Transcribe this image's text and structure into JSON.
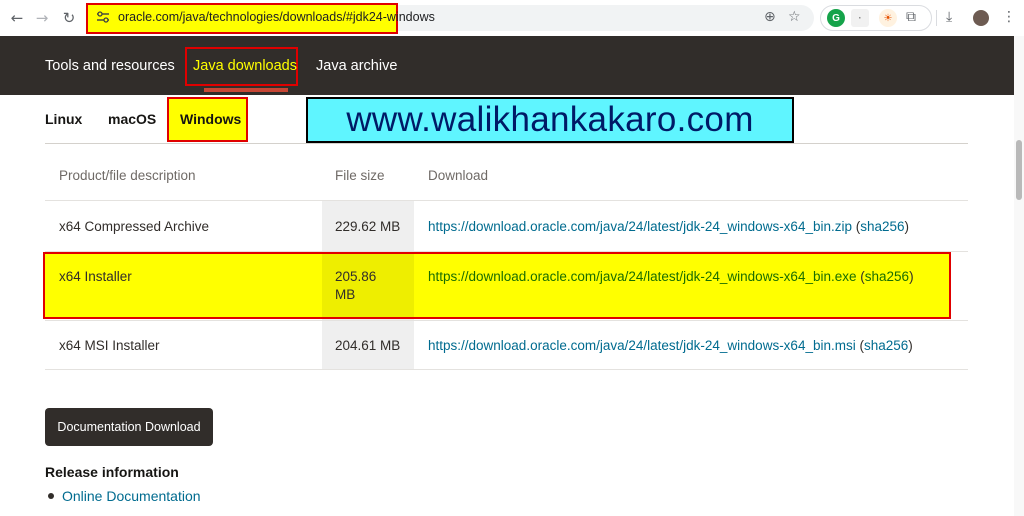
{
  "browser": {
    "url": "oracle.com/java/technologies/downloads/#jdk24-windows",
    "icons": [
      "back-icon",
      "forward-icon",
      "reload-icon",
      "site-info-icon",
      "zoom-icon",
      "bookmark-star-icon",
      "extension-puzzle-icon",
      "download-icon",
      "profile-avatar",
      "menu-icon"
    ]
  },
  "topnav": {
    "items": [
      "Tools and resources",
      "Java downloads",
      "Java archive"
    ],
    "active": "Java downloads"
  },
  "os_tabs": {
    "items": [
      "Linux",
      "macOS",
      "Windows"
    ],
    "active": "Windows"
  },
  "watermark": "www.walikhankakaro.com",
  "table": {
    "headers": [
      "Product/file description",
      "File size",
      "Download"
    ],
    "rows": [
      {
        "description": "x64 Compressed Archive",
        "size": "229.62 MB",
        "link": "https://download.oracle.com/java/24/latest/jdk-24_windows-x64_bin.zip",
        "checksum": "sha256"
      },
      {
        "description": "x64 Installer",
        "size_line1": "205.86",
        "size_line2": "MB",
        "link": "https://download.oracle.com/java/24/latest/jdk-24_windows-x64_bin.exe",
        "checksum": "sha256"
      },
      {
        "description": "x64 MSI Installer",
        "size": "204.61 MB",
        "link": "https://download.oracle.com/java/24/latest/jdk-24_windows-x64_bin.msi",
        "checksum": "sha256"
      }
    ]
  },
  "documentation_button": "Documentation Download",
  "release": {
    "title": "Release information",
    "links": [
      "Online Documentation"
    ]
  },
  "colors": {
    "nav_bg": "#312d2a",
    "link": "#006b8f",
    "highlight": "#ffff00",
    "highlight_border": "#e00000",
    "watermark_bg": "#5ff5ff"
  }
}
